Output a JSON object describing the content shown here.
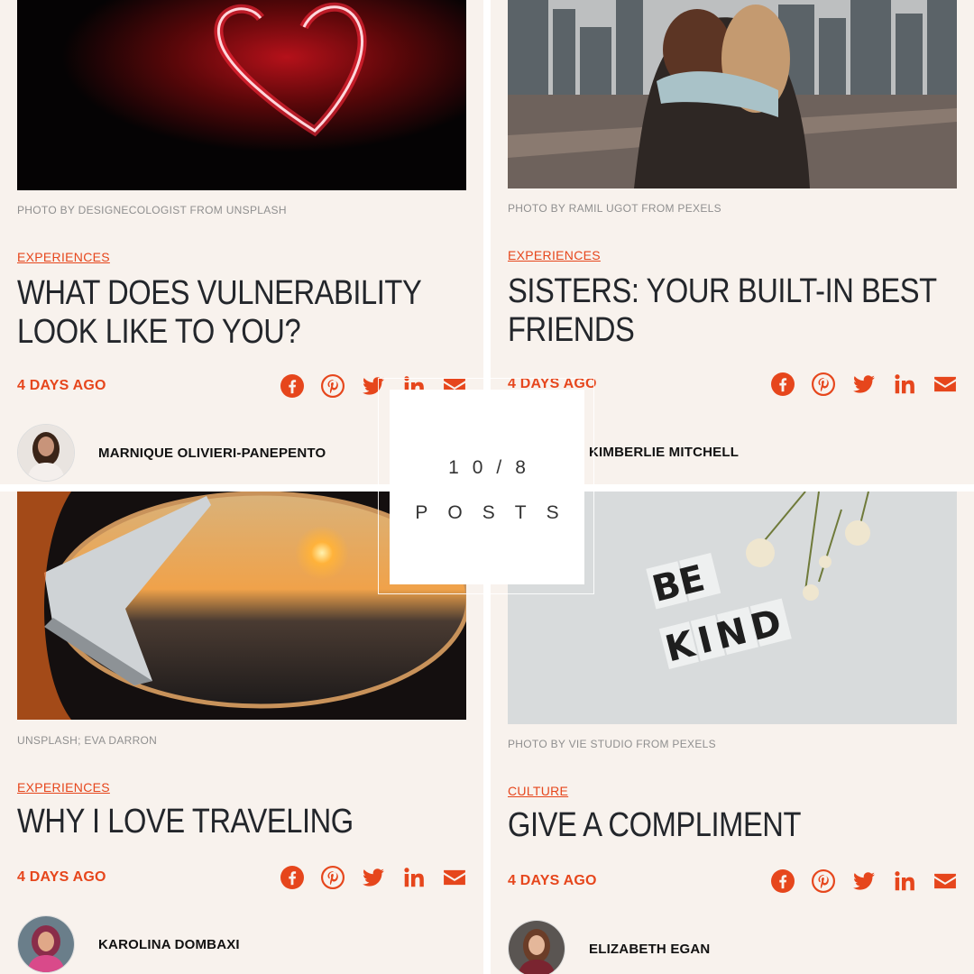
{
  "overlay": {
    "count": "10/8",
    "label": "POSTS"
  },
  "posts": [
    {
      "image": "neon-heart-photo",
      "credit": "PHOTO BY DESIGNECOLOGIST FROM UNSPLASH",
      "category": "EXPERIENCES",
      "title": "WHAT DOES VULNERABILITY LOOK LIKE TO YOU?",
      "date": "4 DAYS AGO",
      "author": "MARNIQUE OLIVIERI-PANEPENTO"
    },
    {
      "image": "sisters-bridge-photo",
      "credit": "PHOTO BY RAMIL UGOT FROM PEXELS",
      "category": "EXPERIENCES",
      "title": "SISTERS: YOUR BUILT-IN BEST FRIENDS",
      "date": "4 DAYS AGO",
      "author": "KIMBERLIE MITCHELL"
    },
    {
      "image": "airplane-window-photo",
      "credit": "UNSPLASH; EVA DARRON",
      "category": "EXPERIENCES",
      "title": "WHY I LOVE TRAVELING",
      "date": "4 DAYS AGO",
      "author": "KAROLINA DOMBAXI"
    },
    {
      "image": "be-kind-photo",
      "credit": "PHOTO BY VIE STUDIO FROM PEXELS",
      "category": "CULTURE",
      "title": "GIVE A COMPLIMENT",
      "date": "4 DAYS AGO",
      "author": "ELIZABETH EGAN"
    }
  ],
  "photo_text": {
    "be": "BE",
    "kind": "KIND"
  },
  "share_icons": [
    "facebook-icon",
    "pinterest-icon",
    "twitter-icon",
    "linkedin-icon",
    "email-icon"
  ],
  "colors": {
    "accent": "#e6461c",
    "card_bg": "#f8f2ed",
    "title": "#23262b"
  }
}
